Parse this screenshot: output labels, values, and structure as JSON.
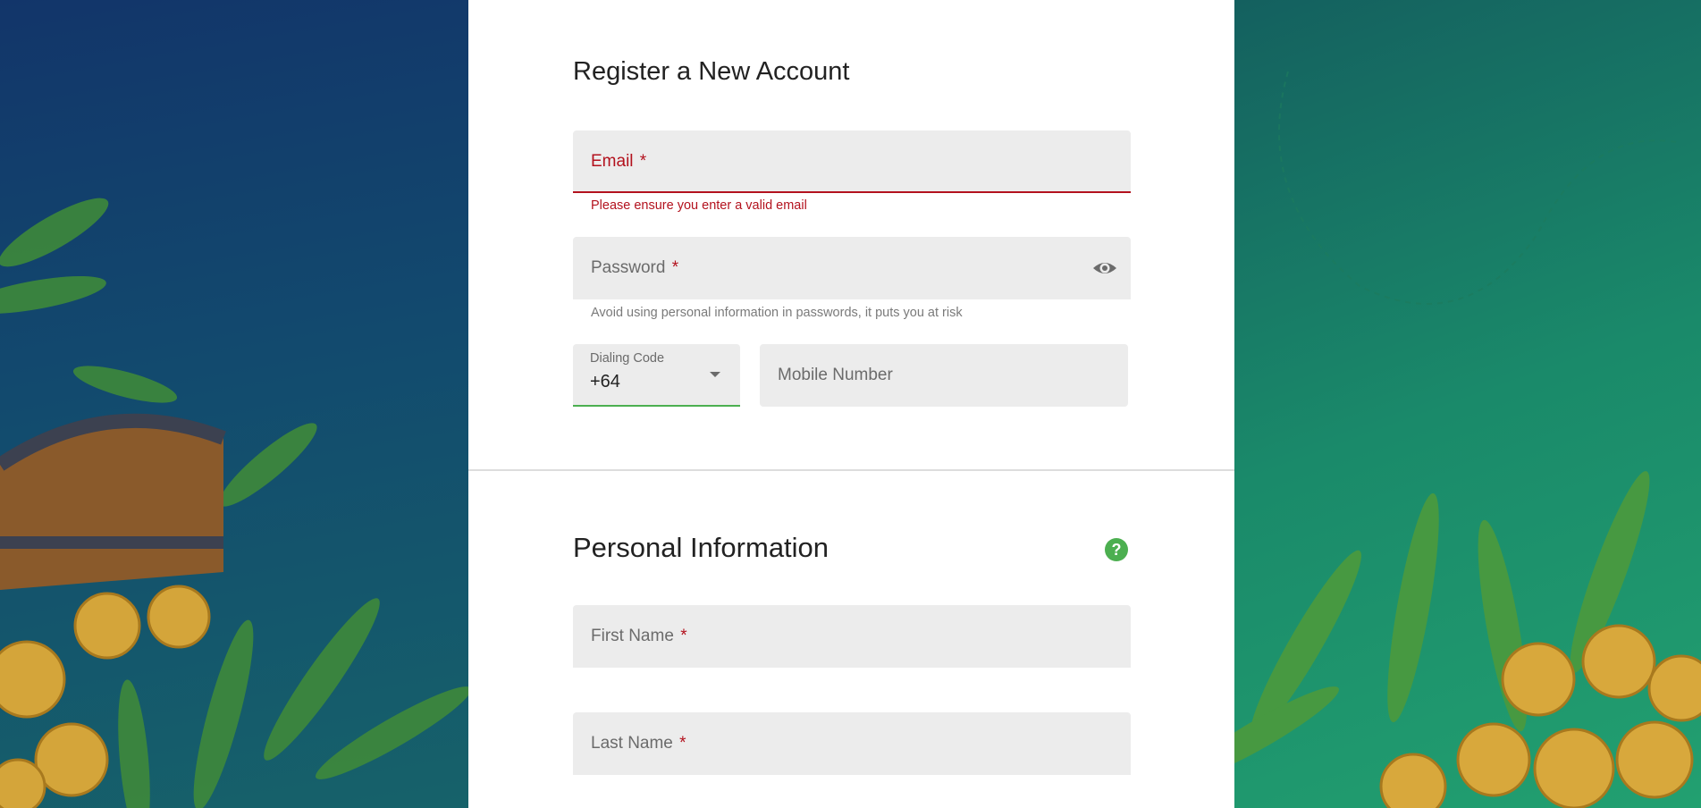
{
  "register_section": {
    "title": "Register a New Account",
    "email": {
      "label": "Email",
      "required_mark": "*",
      "value": "",
      "error": "Please ensure you enter a valid email"
    },
    "password": {
      "label": "Password",
      "required_mark": "*",
      "value": "",
      "helper": "Avoid using personal information in passwords, it puts you at risk",
      "toggle_icon": "eye-icon"
    },
    "dialing_code": {
      "caption": "Dialing Code",
      "value": "+64"
    },
    "mobile": {
      "label": "Mobile Number",
      "value": ""
    }
  },
  "personal_section": {
    "title": "Personal Information",
    "help_icon": "?",
    "first_name": {
      "label": "First Name",
      "required_mark": "*",
      "value": ""
    },
    "last_name": {
      "label": "Last Name",
      "required_mark": "*",
      "value": ""
    }
  },
  "colors": {
    "error": "#b3121e",
    "accent": "#4caf50",
    "field_bg": "#ececec",
    "panel_bg": "#ffffff"
  }
}
